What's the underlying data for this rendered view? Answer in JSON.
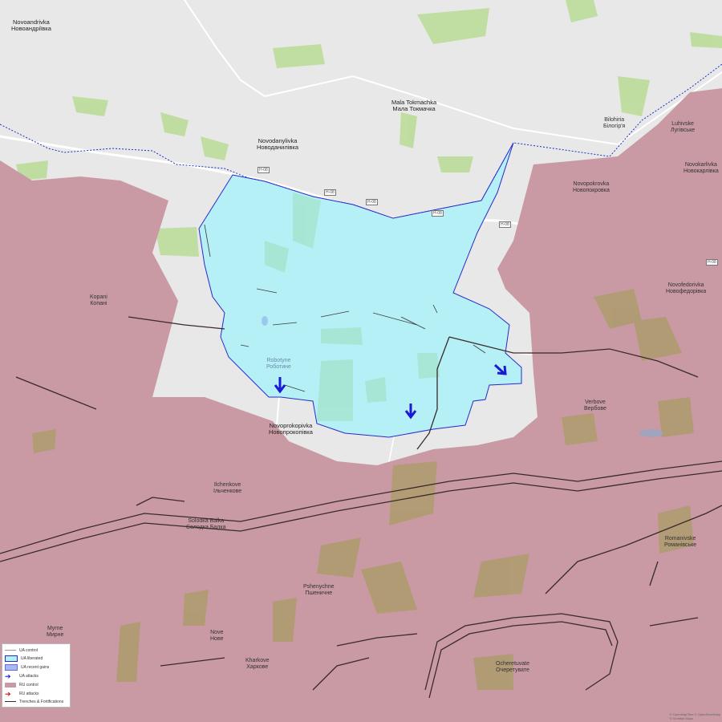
{
  "colors": {
    "base": "#e8e8e8",
    "ru_control": "#c99aa3",
    "ua_liberated": "#b5f0f7",
    "ua_liberated_border": "#2a2ac9",
    "gray_zone": "#ececec",
    "fields": "#b8dc94",
    "ua_attack": "#1a1ad6",
    "ru_attack": "#cc1111",
    "trench": "#3a2a2a",
    "border_line": "#1a30c8",
    "road": "#ffffff",
    "olive_fields": "#a89c62"
  },
  "places": [
    {
      "key": "novoandriivka",
      "lat": "Novoandrivka",
      "cyr": "Новоандріївка"
    },
    {
      "key": "mala_tokmachka",
      "lat": "Mala Tokmachka",
      "cyr": "Мала Токмачка"
    },
    {
      "key": "bilohiria",
      "lat": "Bilohiria",
      "cyr": "Білогір'я"
    },
    {
      "key": "novodanylivka",
      "lat": "Novodanylivka",
      "cyr": "Новоданилівка"
    },
    {
      "key": "luhivske",
      "lat": "Luhivske",
      "cyr": "Лугівське"
    },
    {
      "key": "novokarlivka",
      "lat": "Novokarlivka",
      "cyr": "Новокарлівка"
    },
    {
      "key": "novopokrovka",
      "lat": "Novopokrovka",
      "cyr": "Новопокровка"
    },
    {
      "key": "kopani",
      "lat": "Kopani",
      "cyr": "Копані"
    },
    {
      "key": "novofedorivka",
      "lat": "Novofedorivka",
      "cyr": "Новофедорівка"
    },
    {
      "key": "robotyne",
      "lat": "Robotyne",
      "cyr": "Роботине"
    },
    {
      "key": "verbove",
      "lat": "Verbove",
      "cyr": "Вербове"
    },
    {
      "key": "novoprokopivka",
      "lat": "Novoprokopivka",
      "cyr": "Новопрокопівка"
    },
    {
      "key": "ilchenkove",
      "lat": "Ilchenkove",
      "cyr": "Ільченкове"
    },
    {
      "key": "solodka_balka",
      "lat": "Solodka Balka",
      "cyr": "Солодка Балка"
    },
    {
      "key": "romanivske",
      "lat": "Romanivske",
      "cyr": "Романівське"
    },
    {
      "key": "pshenychne",
      "lat": "Pshenychne",
      "cyr": "Пшеничне"
    },
    {
      "key": "myrne",
      "lat": "Myrne",
      "cyr": "Мирне"
    },
    {
      "key": "nove",
      "lat": "Nove",
      "cyr": "Нове"
    },
    {
      "key": "kharkove",
      "lat": "Kharkove",
      "cyr": "Харкове"
    },
    {
      "key": "ocheretuvate",
      "lat": "Ocheretuvate",
      "cyr": "Очеретувате"
    }
  ],
  "road_labels": [
    "H-08",
    "H-08",
    "H-08",
    "H-08",
    "H-08",
    "H-08"
  ],
  "legend": {
    "items": [
      {
        "label": "UA control",
        "swatch": "line-thin"
      },
      {
        "label": "UA liberated",
        "swatch": "cyan"
      },
      {
        "label": "UA recent gains",
        "swatch": "blue"
      },
      {
        "label": "UA attacks",
        "swatch": "blue-arrow"
      },
      {
        "label": "RU control",
        "swatch": "pink"
      },
      {
        "label": "RU attacks",
        "swatch": "red-arrow"
      },
      {
        "label": "Trenches & Fortifications",
        "swatch": "line-dark"
      }
    ]
  },
  "attribution": {
    "line1": "© OpenMapTiles © OpenStreetMap",
    "line2": "© Scribble Maps"
  }
}
